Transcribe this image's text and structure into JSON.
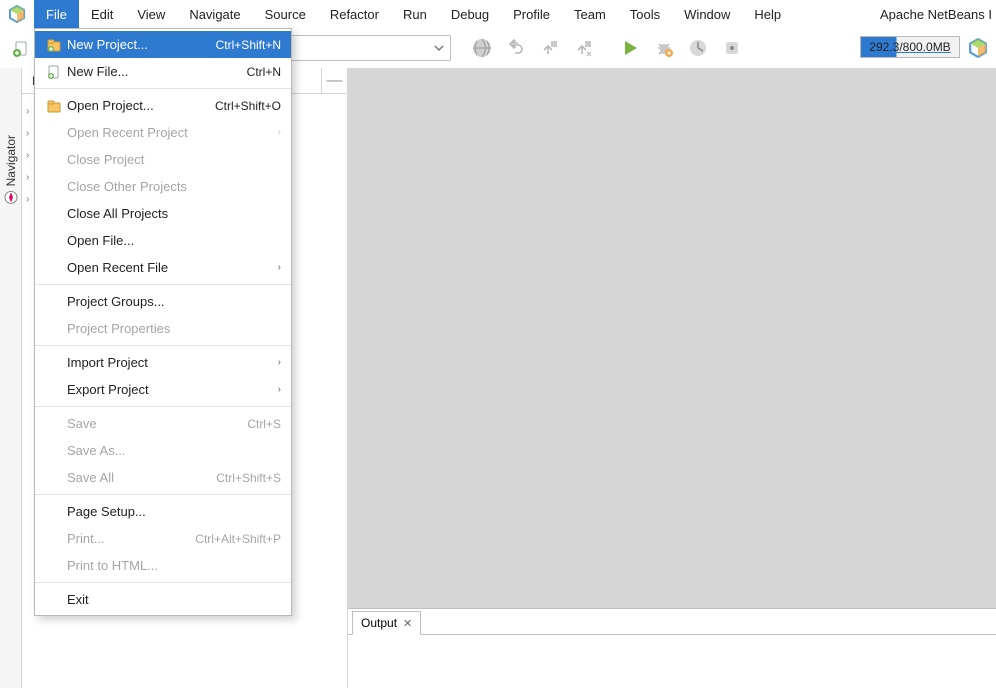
{
  "app_title": "Apache NetBeans I",
  "menubar": [
    "File",
    "Edit",
    "View",
    "Navigate",
    "Source",
    "Refactor",
    "Run",
    "Debug",
    "Profile",
    "Team",
    "Tools",
    "Window",
    "Help"
  ],
  "menubar_open_index": 0,
  "memory": "292.3/800.0MB",
  "side_tab": {
    "label": "Navigator"
  },
  "left_panel": {
    "tab_visible_letter": "P",
    "tree_rows_count": 5
  },
  "output": {
    "tab_label": "Output"
  },
  "file_menu": [
    {
      "type": "item",
      "label": "New Project...",
      "shortcut": "Ctrl+Shift+N",
      "icon": "new-project",
      "selected": true
    },
    {
      "type": "item",
      "label": "New File...",
      "shortcut": "Ctrl+N",
      "icon": "new-file"
    },
    {
      "type": "sep"
    },
    {
      "type": "item",
      "label": "Open Project...",
      "shortcut": "Ctrl+Shift+O",
      "icon": "open-project"
    },
    {
      "type": "item",
      "label": "Open Recent Project",
      "submenu": true,
      "disabled": true
    },
    {
      "type": "item",
      "label": "Close Project",
      "disabled": true
    },
    {
      "type": "item",
      "label": "Close Other Projects",
      "disabled": true
    },
    {
      "type": "item",
      "label": "Close All Projects"
    },
    {
      "type": "item",
      "label": "Open File..."
    },
    {
      "type": "item",
      "label": "Open Recent File",
      "submenu": true
    },
    {
      "type": "sep"
    },
    {
      "type": "item",
      "label": "Project Groups..."
    },
    {
      "type": "item",
      "label": "Project Properties",
      "disabled": true
    },
    {
      "type": "sep"
    },
    {
      "type": "item",
      "label": "Import Project",
      "submenu": true
    },
    {
      "type": "item",
      "label": "Export Project",
      "submenu": true
    },
    {
      "type": "sep"
    },
    {
      "type": "item",
      "label": "Save",
      "shortcut": "Ctrl+S",
      "disabled": true
    },
    {
      "type": "item",
      "label": "Save As...",
      "disabled": true
    },
    {
      "type": "item",
      "label": "Save All",
      "shortcut": "Ctrl+Shift+S",
      "disabled": true
    },
    {
      "type": "sep"
    },
    {
      "type": "item",
      "label": "Page Setup..."
    },
    {
      "type": "item",
      "label": "Print...",
      "shortcut": "Ctrl+Alt+Shift+P",
      "disabled": true
    },
    {
      "type": "item",
      "label": "Print to HTML...",
      "disabled": true
    },
    {
      "type": "sep"
    },
    {
      "type": "item",
      "label": "Exit"
    }
  ]
}
